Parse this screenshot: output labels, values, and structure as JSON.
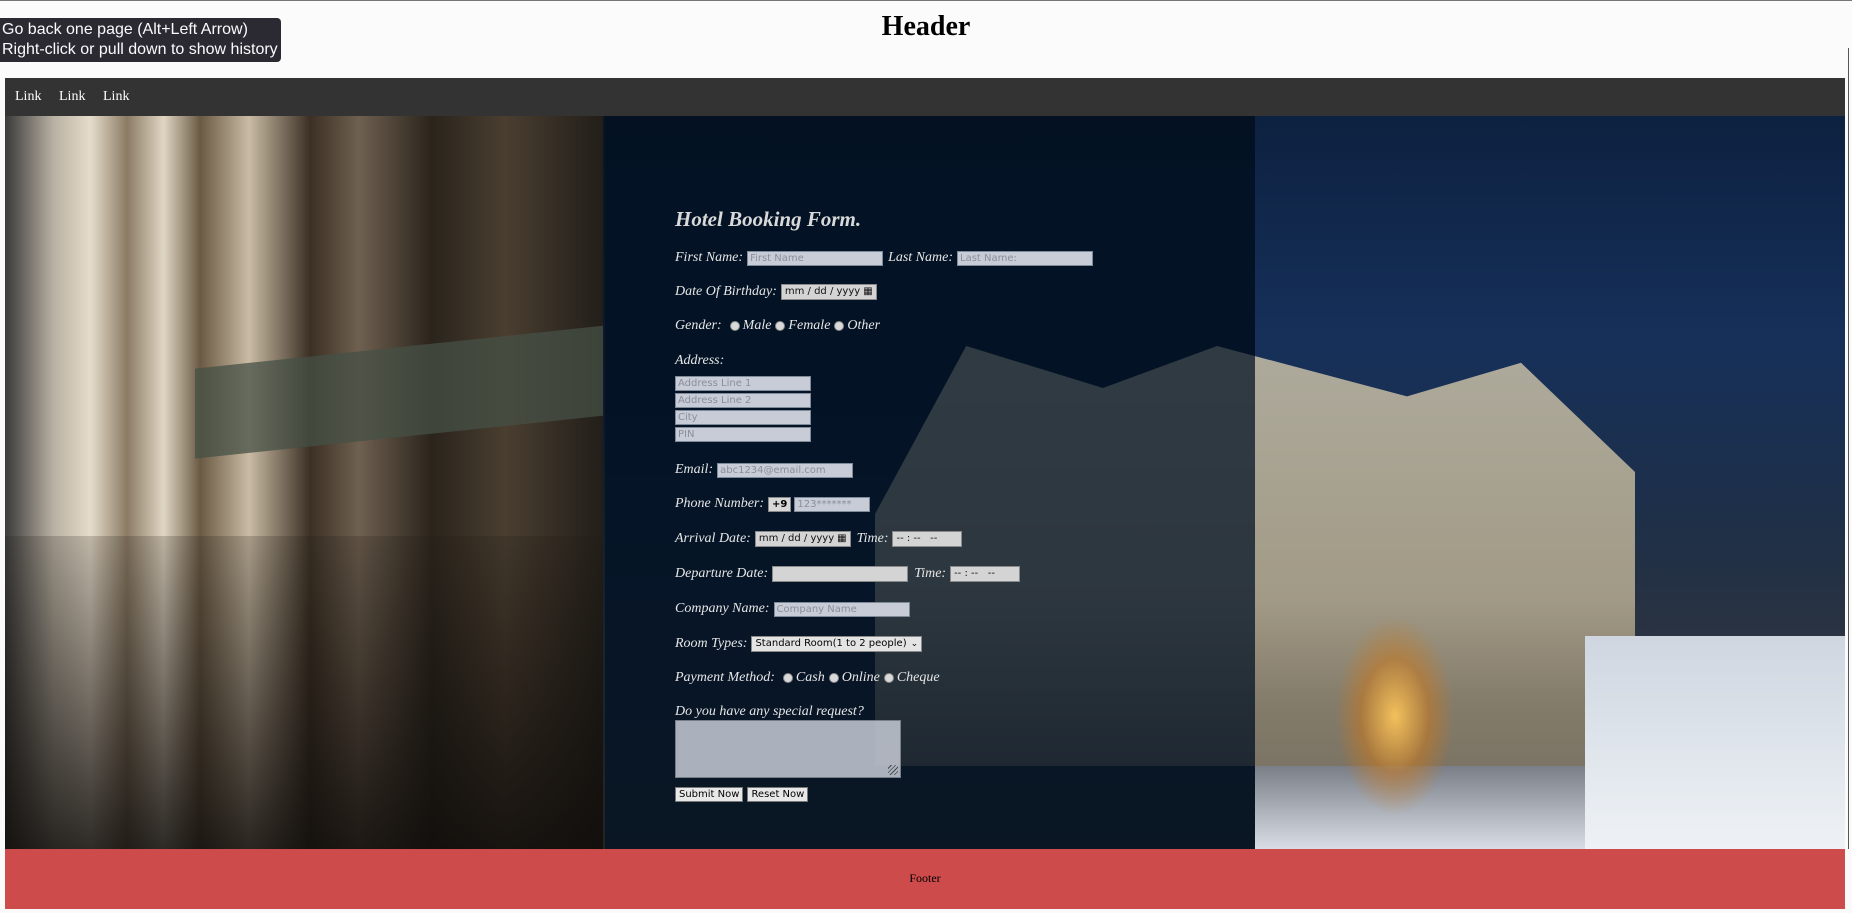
{
  "header": {
    "title": "Header"
  },
  "tooltip": {
    "line1": "Go back one page (Alt+Left Arrow)",
    "line2": "Right-click or pull down to show history"
  },
  "nav": {
    "links": [
      "Link",
      "Link",
      "Link"
    ]
  },
  "form": {
    "title": "Hotel Booking Form.",
    "first_name": {
      "label": "First Name:",
      "placeholder": "First Name"
    },
    "last_name": {
      "label": "Last Name:",
      "placeholder": "Last Name:"
    },
    "dob": {
      "label": "Date Of Birthday:",
      "value": "mm / dd / yyyy"
    },
    "gender": {
      "label": "Gender:",
      "options": [
        "Male",
        "Female",
        "Other"
      ]
    },
    "address": {
      "label": "Address:",
      "line1": "Address Line 1",
      "line2": "Address Line 2",
      "city": "City",
      "pin": "PIN"
    },
    "email": {
      "label": "Email:",
      "placeholder": "abc1234@email.com"
    },
    "phone": {
      "label": "Phone Number:",
      "code": "+9",
      "placeholder": "123*******"
    },
    "arrival": {
      "label": "Arrival Date:",
      "value": "mm / dd / yyyy",
      "time_label": "Time:",
      "time_value": "-- : --   --"
    },
    "departure": {
      "label": "Departure Date:",
      "value": "",
      "time_label": "Time:",
      "time_value": "-- : --   --"
    },
    "company": {
      "label": "Company Name:",
      "placeholder": "Company Name"
    },
    "room": {
      "label": "Room Types:",
      "selected": "Standard Room(1 to 2 people)"
    },
    "payment": {
      "label": "Payment Method:",
      "options": [
        "Cash",
        "Online",
        "Cheque"
      ]
    },
    "special": {
      "label": "Do you have any special request?"
    },
    "submit": "Submit Now",
    "reset": "Reset Now"
  },
  "footer": {
    "text": "Footer"
  },
  "colors": {
    "nav_bg": "#333333",
    "footer_bg": "#cd4b4b",
    "overlay": "#001024"
  }
}
